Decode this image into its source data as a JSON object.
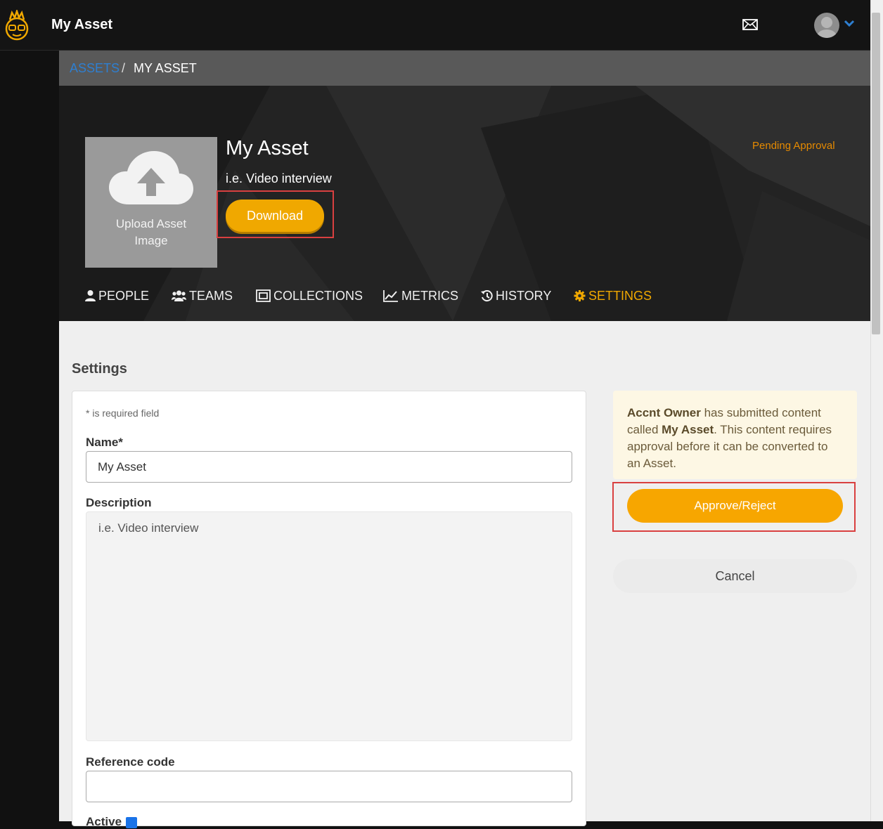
{
  "header": {
    "app_title": "My Asset"
  },
  "breadcrumb": {
    "link": "ASSETS",
    "separator": "/",
    "current": "MY ASSET"
  },
  "asset": {
    "upload_label_line1": "Upload Asset",
    "upload_label_line2": "Image",
    "title": "My Asset",
    "subtitle": "i.e. Video interview",
    "download_label": "Download",
    "status": "Pending Approval"
  },
  "tabs": [
    {
      "label": "PEOPLE",
      "icon": "person-icon"
    },
    {
      "label": "TEAMS",
      "icon": "group-icon"
    },
    {
      "label": "COLLECTIONS",
      "icon": "collection-icon"
    },
    {
      "label": "METRICS",
      "icon": "chart-icon"
    },
    {
      "label": "HISTORY",
      "icon": "history-icon"
    },
    {
      "label": "SETTINGS",
      "icon": "gear-icon"
    }
  ],
  "settings": {
    "heading": "Settings",
    "required_note": "* is required field",
    "name_label": "Name*",
    "name_value": "My Asset",
    "description_label": "Description",
    "description_value": "i.e. Video interview",
    "reference_label": "Reference code",
    "reference_value": "",
    "active_label": "Active"
  },
  "approval": {
    "owner": "Accnt Owner",
    "text_1": " has submitted content called ",
    "asset": "My Asset",
    "text_2": ". This content requires approval before it can be converted to an Asset.",
    "approve_label": "Approve/Reject",
    "cancel_label": "Cancel"
  },
  "colors": {
    "accent": "#f0a800",
    "status": "#e68a00",
    "link": "#2e7fd1",
    "highlight": "#d94040"
  }
}
